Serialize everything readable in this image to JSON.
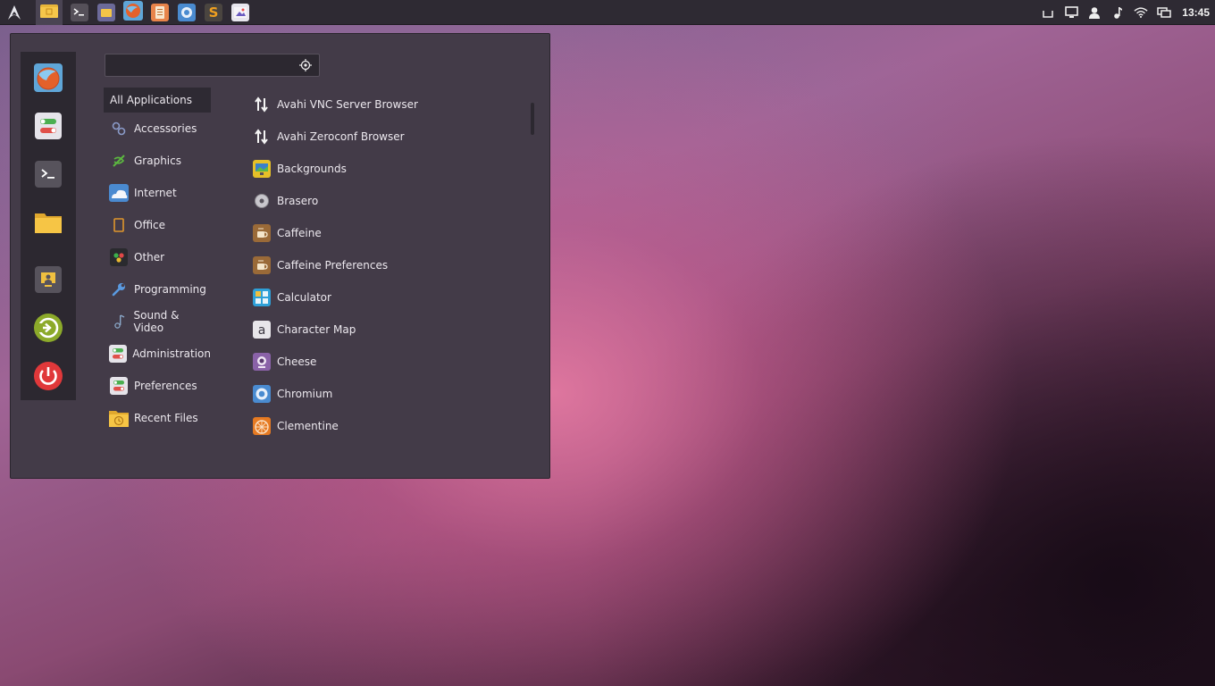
{
  "panel": {
    "menu_icon": "arch-logo-icon",
    "launchers": [
      {
        "name": "files-launcher",
        "icon": "folder-icon",
        "active": true
      },
      {
        "name": "terminal-launcher",
        "icon": "terminal-icon"
      },
      {
        "name": "nemo-launcher",
        "icon": "folder-purple-icon"
      },
      {
        "name": "firefox-launcher",
        "icon": "firefox-icon"
      },
      {
        "name": "document-launcher",
        "icon": "document-icon"
      },
      {
        "name": "chromium-launcher",
        "icon": "chromium-icon"
      },
      {
        "name": "sublime-launcher",
        "icon": "sublime-icon"
      },
      {
        "name": "image-viewer-launcher",
        "icon": "image-icon"
      }
    ],
    "tray": [
      "eject-icon",
      "display-icon",
      "user-icon",
      "music-icon",
      "wifi-icon",
      "workspace-icon"
    ],
    "clock": "13:45"
  },
  "search": {
    "value": "",
    "placeholder": ""
  },
  "favorites": [
    "firefox-icon",
    "settings-toggle-icon",
    "terminal-icon",
    "folder-icon",
    "lock-screen-icon",
    "logout-icon",
    "power-icon"
  ],
  "categories": [
    {
      "label": "All Applications",
      "icon": "none"
    },
    {
      "label": "Accessories",
      "icon": "accessories-icon"
    },
    {
      "label": "Graphics",
      "icon": "graphics-icon"
    },
    {
      "label": "Internet",
      "icon": "internet-cloud-icon"
    },
    {
      "label": "Office",
      "icon": "office-icon"
    },
    {
      "label": "Other",
      "icon": "other-icon"
    },
    {
      "label": "Programming",
      "icon": "wrench-icon"
    },
    {
      "label": "Sound & Video",
      "icon": "music-note-icon"
    },
    {
      "label": "Administration",
      "icon": "administration-icon"
    },
    {
      "label": "Preferences",
      "icon": "preferences-icon"
    },
    {
      "label": "Recent Files",
      "icon": "recent-files-icon"
    }
  ],
  "apps": [
    {
      "label": "Avahi VNC Server Browser",
      "icon": "updown-arrows-icon"
    },
    {
      "label": "Avahi Zeroconf Browser",
      "icon": "updown-arrows-icon"
    },
    {
      "label": "Backgrounds",
      "icon": "backgrounds-icon"
    },
    {
      "label": "Brasero",
      "icon": "disc-icon"
    },
    {
      "label": "Caffeine",
      "icon": "coffee-cup-icon"
    },
    {
      "label": "Caffeine Preferences",
      "icon": "coffee-cup-icon"
    },
    {
      "label": "Calculator",
      "icon": "calculator-icon"
    },
    {
      "label": "Character Map",
      "icon": "character-map-icon"
    },
    {
      "label": "Cheese",
      "icon": "webcam-icon"
    },
    {
      "label": "Chromium",
      "icon": "chromium-icon"
    },
    {
      "label": "Clementine",
      "icon": "clementine-icon"
    }
  ],
  "colors": {
    "panel": "#2e2a33",
    "menu_bg": "#433b48",
    "sidebar_bg": "#2c2830",
    "selected_bg": "#2e2a33"
  }
}
